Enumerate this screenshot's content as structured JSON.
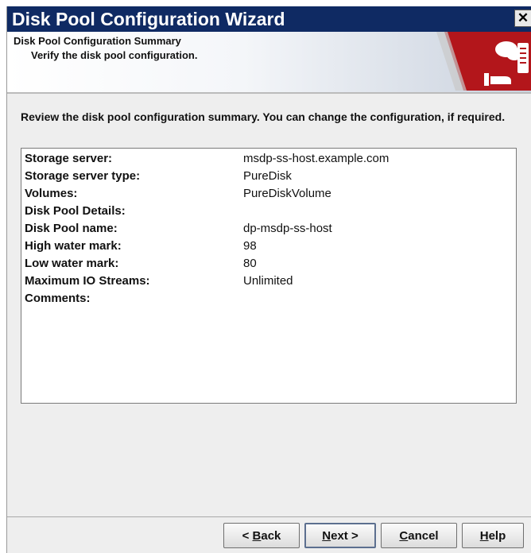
{
  "window": {
    "title": "Disk Pool Configuration Wizard",
    "close_glyph": "✕"
  },
  "header": {
    "title": "Disk Pool Configuration Summary",
    "subtitle": "Verify the disk pool configuration.",
    "logo_icon": "storage-cloud-icon",
    "accent_color": "#b3161b"
  },
  "instructions": "Review the disk pool configuration summary. You can change the configuration, if required.",
  "summary": [
    {
      "label": "Storage server:",
      "value": "msdp-ss-host.example.com"
    },
    {
      "label": "Storage server type:",
      "value": "PureDisk"
    },
    {
      "label": "Volumes:",
      "value": "PureDiskVolume"
    },
    {
      "label": "Disk Pool Details:",
      "value": ""
    },
    {
      "label": "Disk Pool name:",
      "value": "dp-msdp-ss-host"
    },
    {
      "label": "High water mark:",
      "value": "98"
    },
    {
      "label": "Low water mark:",
      "value": "80"
    },
    {
      "label": "Maximum IO Streams:",
      "value": "Unlimited"
    },
    {
      "label": "Comments:",
      "value": ""
    }
  ],
  "buttons": {
    "back": {
      "prefix": "< ",
      "mnemonic": "B",
      "rest": "ack"
    },
    "next": {
      "mnemonic": "N",
      "rest": "ext >"
    },
    "cancel": {
      "mnemonic": "C",
      "rest": "ancel"
    },
    "help": {
      "mnemonic": "H",
      "rest": "elp"
    }
  }
}
